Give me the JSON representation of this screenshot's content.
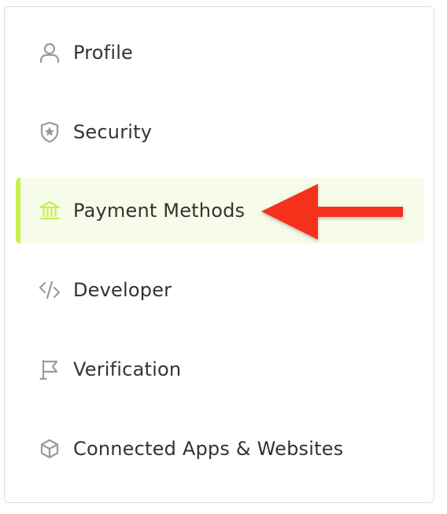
{
  "colors": {
    "accent": "#c6ef4e",
    "active_bg": "#f7fbe9",
    "icon_gray": "#9a9a9a",
    "arrow_red": "#f4321e"
  },
  "nav": {
    "items": [
      {
        "label": "Profile",
        "icon": "user-icon",
        "active": false
      },
      {
        "label": "Security",
        "icon": "shield-star-icon",
        "active": false
      },
      {
        "label": "Payment Methods",
        "icon": "bank-icon",
        "active": true
      },
      {
        "label": "Developer",
        "icon": "code-icon",
        "active": false
      },
      {
        "label": "Verification",
        "icon": "flag-icon",
        "active": false
      },
      {
        "label": "Connected Apps & Websites",
        "icon": "cube-icon",
        "active": false
      }
    ]
  },
  "annotation": {
    "icon": "red-arrow-icon",
    "points_to": "Payment Methods"
  }
}
